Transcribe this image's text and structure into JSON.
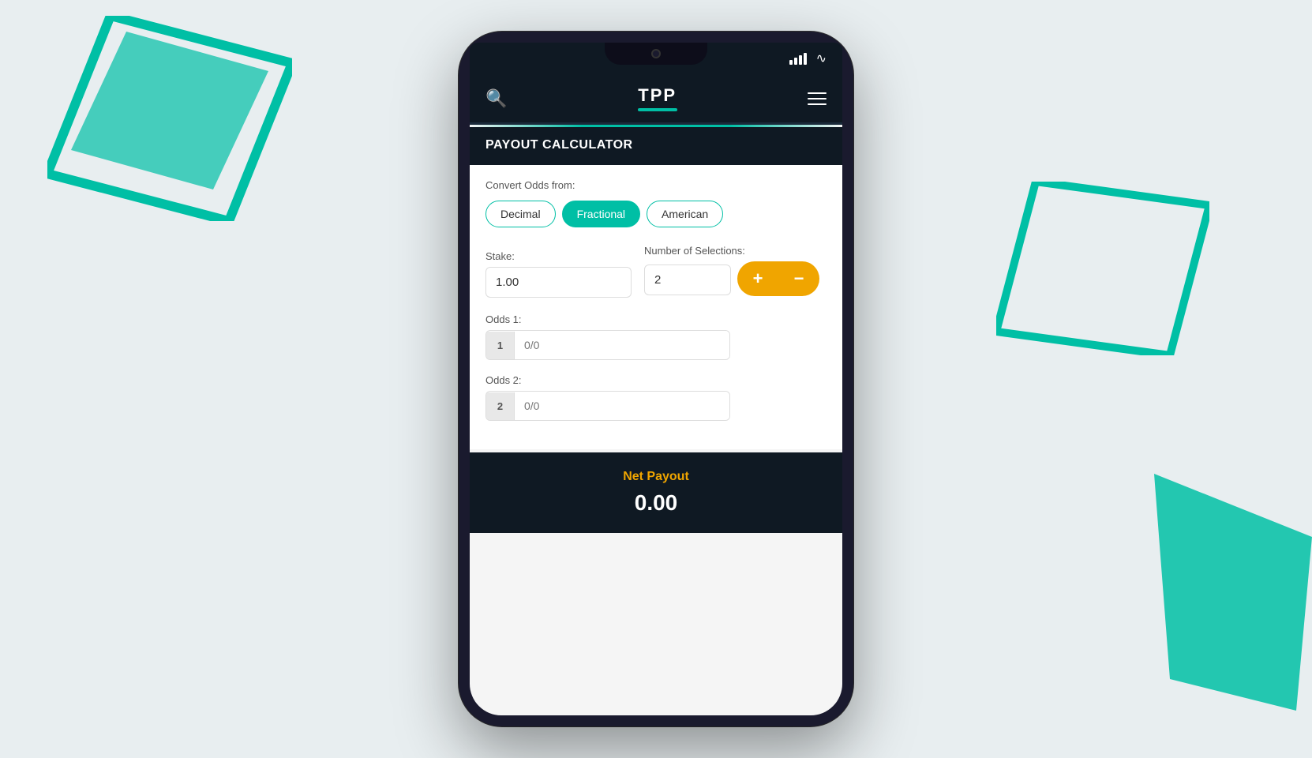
{
  "background": {
    "color": "#dfe8ea"
  },
  "header": {
    "logo": "TPP",
    "search_icon": "🔍",
    "menu_icon": "≡"
  },
  "section": {
    "title": "PAYOUT CALCULATOR"
  },
  "convert_odds": {
    "label": "Convert Odds from:",
    "buttons": [
      {
        "id": "decimal",
        "label": "Decimal",
        "active": false
      },
      {
        "id": "fractional",
        "label": "Fractional",
        "active": true
      },
      {
        "id": "american",
        "label": "American",
        "active": false
      }
    ]
  },
  "stake": {
    "label": "Stake:",
    "value": "1.00",
    "placeholder": "1.00"
  },
  "selections": {
    "label": "Number of Selections:",
    "value": "2",
    "plus_label": "+",
    "minus_label": "−"
  },
  "odds": [
    {
      "label": "Odds 1:",
      "badge": "1",
      "value": "0/0",
      "placeholder": "0/0"
    },
    {
      "label": "Odds 2:",
      "badge": "2",
      "value": "0/0",
      "placeholder": "0/0"
    }
  ],
  "payout": {
    "label": "Net Payout",
    "value": "0.00"
  },
  "status_bar": {
    "signal": "●●●●",
    "wifi": "wifi"
  }
}
